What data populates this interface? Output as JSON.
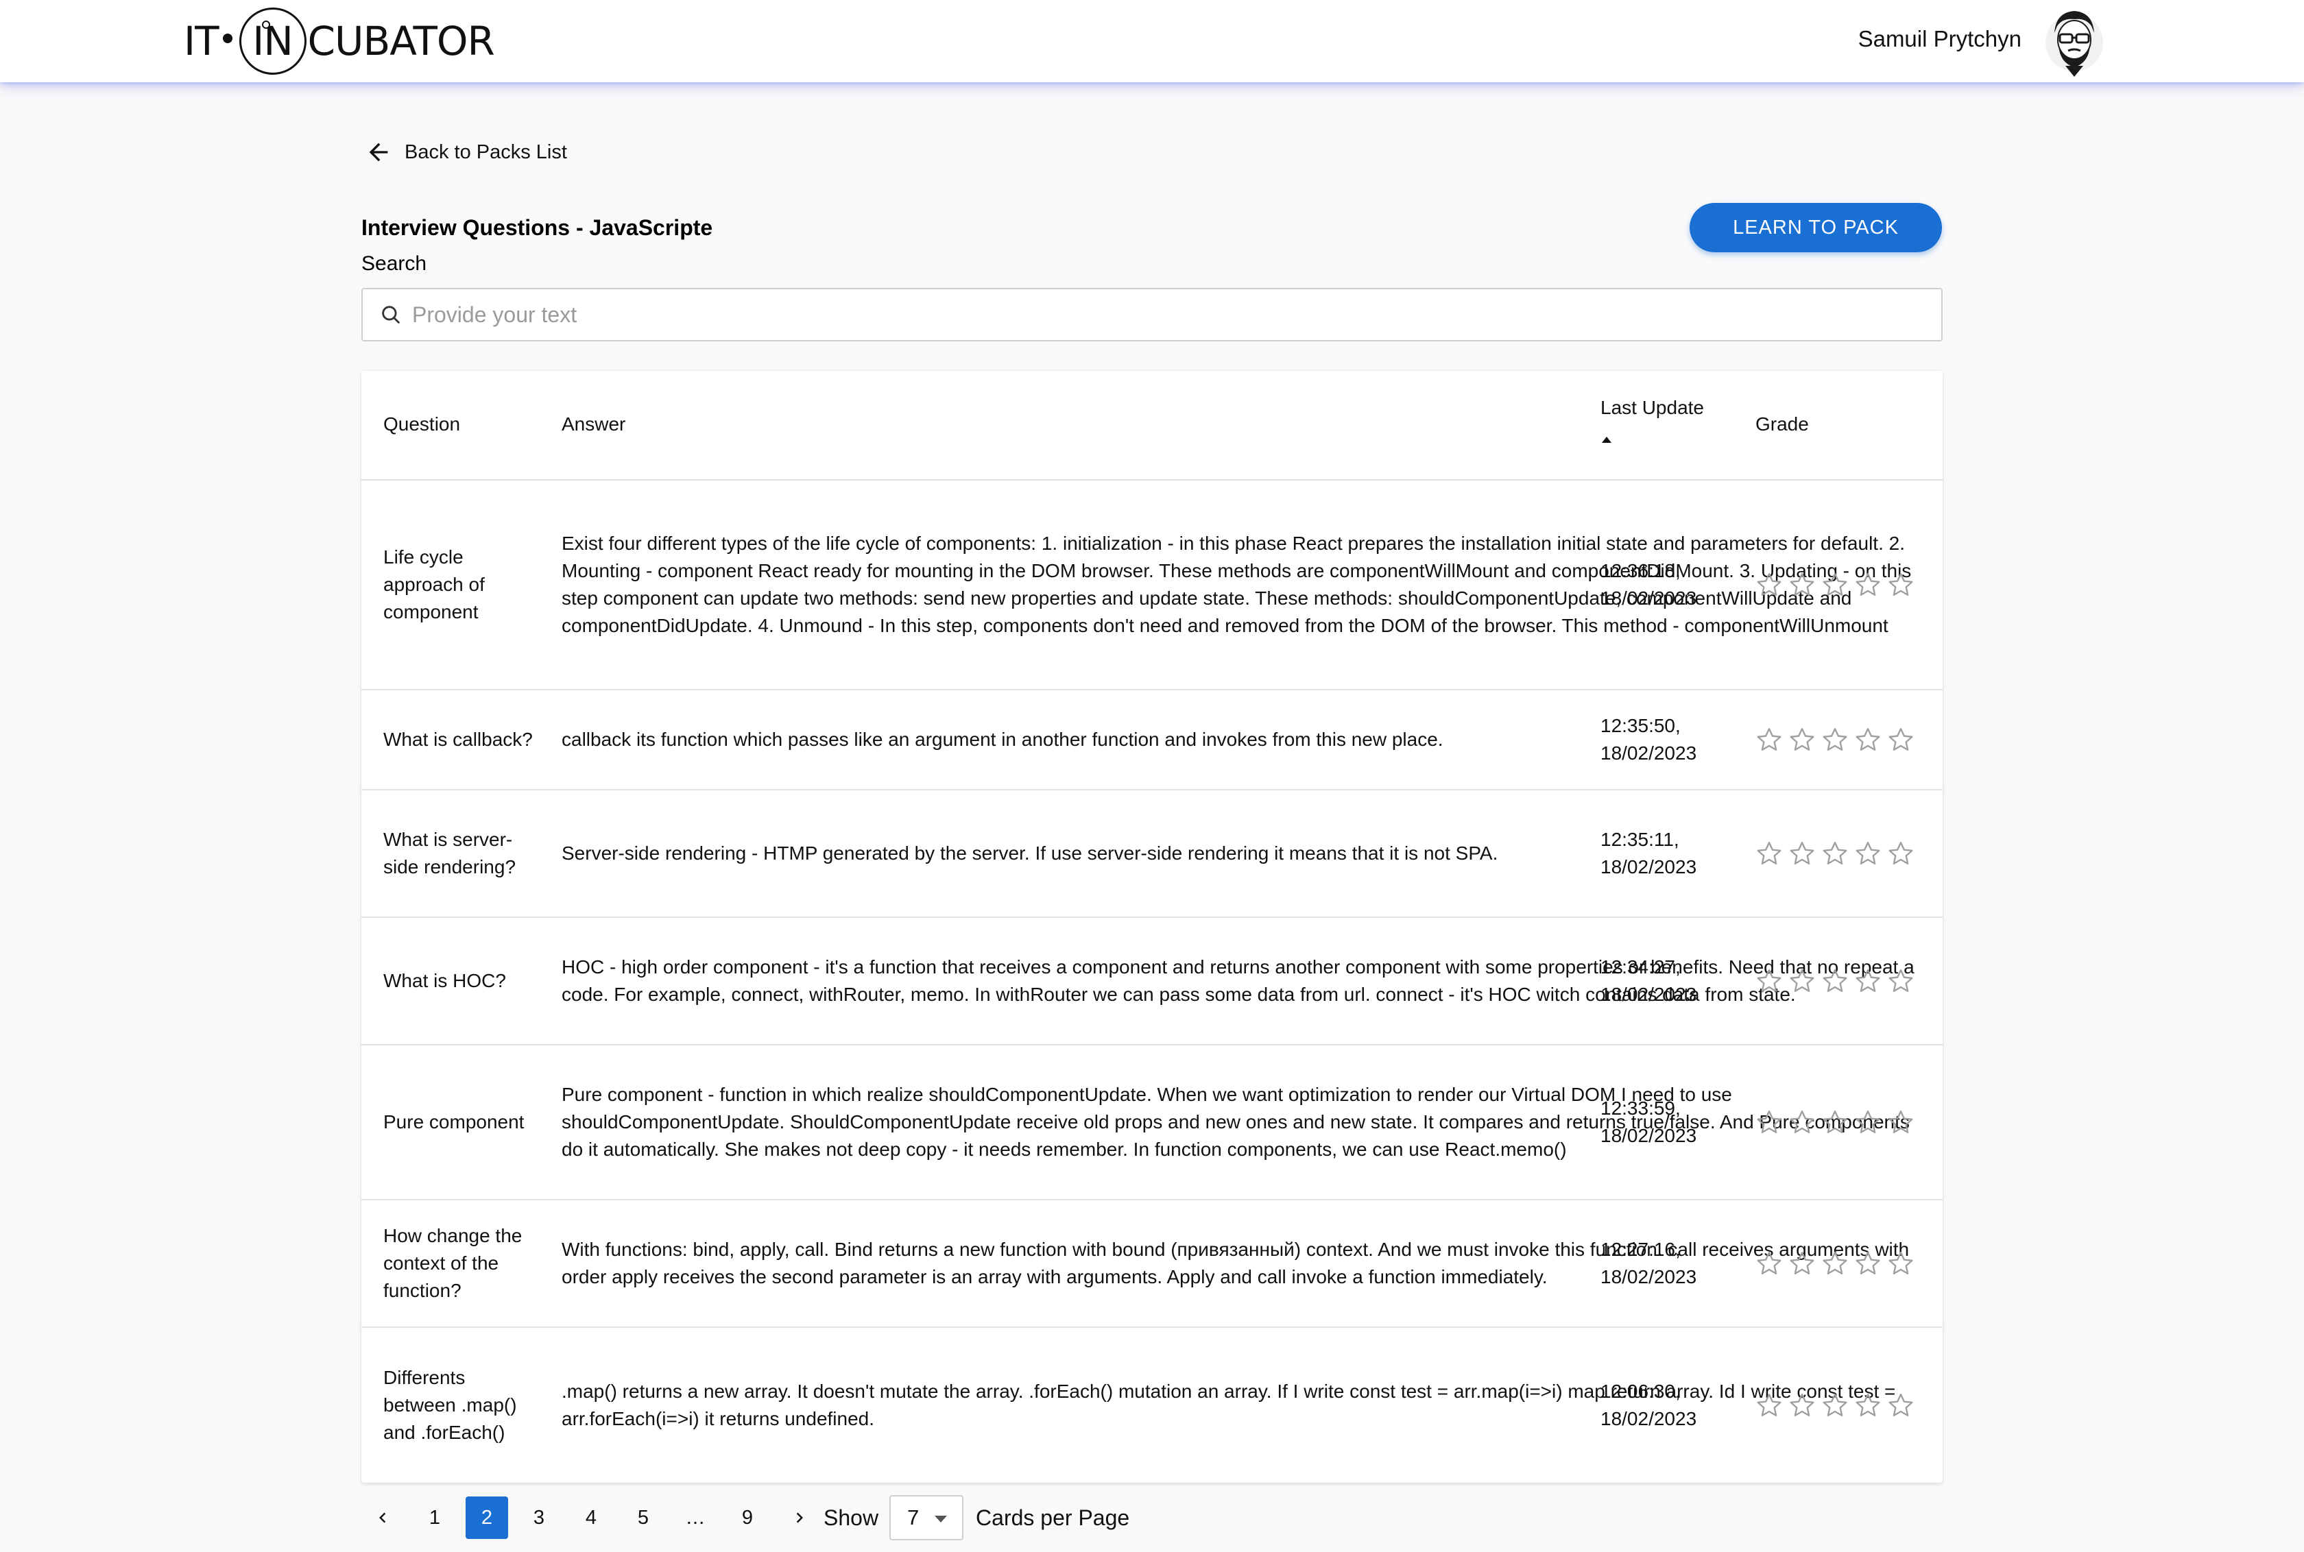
{
  "header": {
    "logo": {
      "part1": "IT",
      "part2": "IN",
      "part3": "CUBATOR"
    },
    "user_name": "Samuil Prytchyn"
  },
  "back_link": "Back to Packs List",
  "pack_title": "Interview Questions - JavaScripte",
  "learn_button": "LEARN TO PACK",
  "search": {
    "label": "Search",
    "placeholder": "Provide your text",
    "value": ""
  },
  "table": {
    "headers": {
      "question": "Question",
      "answer": "Answer",
      "last_update": "Last Update",
      "grade": "Grade"
    },
    "sort": {
      "column": "last_update",
      "direction": "ascending-indicator"
    },
    "rows": [
      {
        "question": "Life cycle approach of component",
        "answer": "Exist four different types of the life cycle of components: 1. initialization - in this phase React prepares the installation initial state and parameters for default. 2. Mounting - component React ready for mounting in the DOM browser. These methods are componentWillMount and componentDidMount. 3. Updating - on this step component can update two methods: send new properties and update state. These methods: shouldComponentUpdate, componentWillUpdate and componentDidUpdate. 4. Unmound - In this step, components don't need and removed from the DOM of the browser. This method - componentWillUnmount",
        "updated": "12:36:18, 18/02/2023",
        "grade": 0
      },
      {
        "question": "What is callback?",
        "answer": "callback its function which passes like an argument in another function and invokes from this new place.",
        "updated": "12:35:50, 18/02/2023",
        "grade": 0
      },
      {
        "question": "What is server-side rendering?",
        "answer": "Server-side rendering - HTMP generated by the server. If use server-side rendering it means that it is not SPA.",
        "updated": "12:35:11, 18/02/2023",
        "grade": 0
      },
      {
        "question": "What is HOC?",
        "answer": "HOC - high order component - it's a function that receives a component and returns another component with some properties or benefits. Need that no repeat a code. For example, connect, withRouter, memo. In withRouter we can pass some data from url. connect - it's HOC witch contains data from state.",
        "updated": "12:34:27, 18/02/2023",
        "grade": 0
      },
      {
        "question": "Pure component",
        "answer": "Pure component - function in which realize shouldComponentUpdate. When we want optimization to render our Virtual DOM I need to use shouldComponentUpdate. ShouldComponentUpdate receive old props and new ones and new state. It compares and returns true/false. And Pure components do it automatically. She makes not deep copy - it needs remember. In function components, we can use React.memo()",
        "updated": "12:33:59, 18/02/2023",
        "grade": 0
      },
      {
        "question": "How change the context of the function?",
        "answer": "With functions: bind, apply, call. Bind returns a new function with bound (привязанный) context. And we must invoke this function. call receives arguments with order apply receives the second parameter is an array with arguments. Apply and call invoke a function immediately.",
        "updated": "12:27:16, 18/02/2023",
        "grade": 0
      },
      {
        "question": "Differents between .map() and .forEach()",
        "answer": ".map() returns a new array. It doesn't mutate the array. .forEach() mutation an array. If I write const test = arr.map(i=>i) map return array. Id I write const test = arr.forEach(i=>i) it returns undefined.",
        "updated": "12:06:30, 18/02/2023",
        "grade": 0
      }
    ]
  },
  "pagination": {
    "pages": [
      "1",
      "2",
      "3",
      "4",
      "5",
      "…",
      "9"
    ],
    "current": "2",
    "show_label": "Show",
    "per_page": "7",
    "per_page_suffix": "Cards per Page"
  },
  "colors": {
    "accent": "#1a6fd3",
    "background": "#f9f9fa",
    "header_shadow": "#636edc",
    "star_outline": "#9e9e9e"
  },
  "icons": {
    "back": "arrow-left-icon",
    "search": "search-icon",
    "star": "star-outline-icon",
    "prev": "chevron-left-icon",
    "next": "chevron-right-icon",
    "dropdown": "caret-down-icon"
  }
}
